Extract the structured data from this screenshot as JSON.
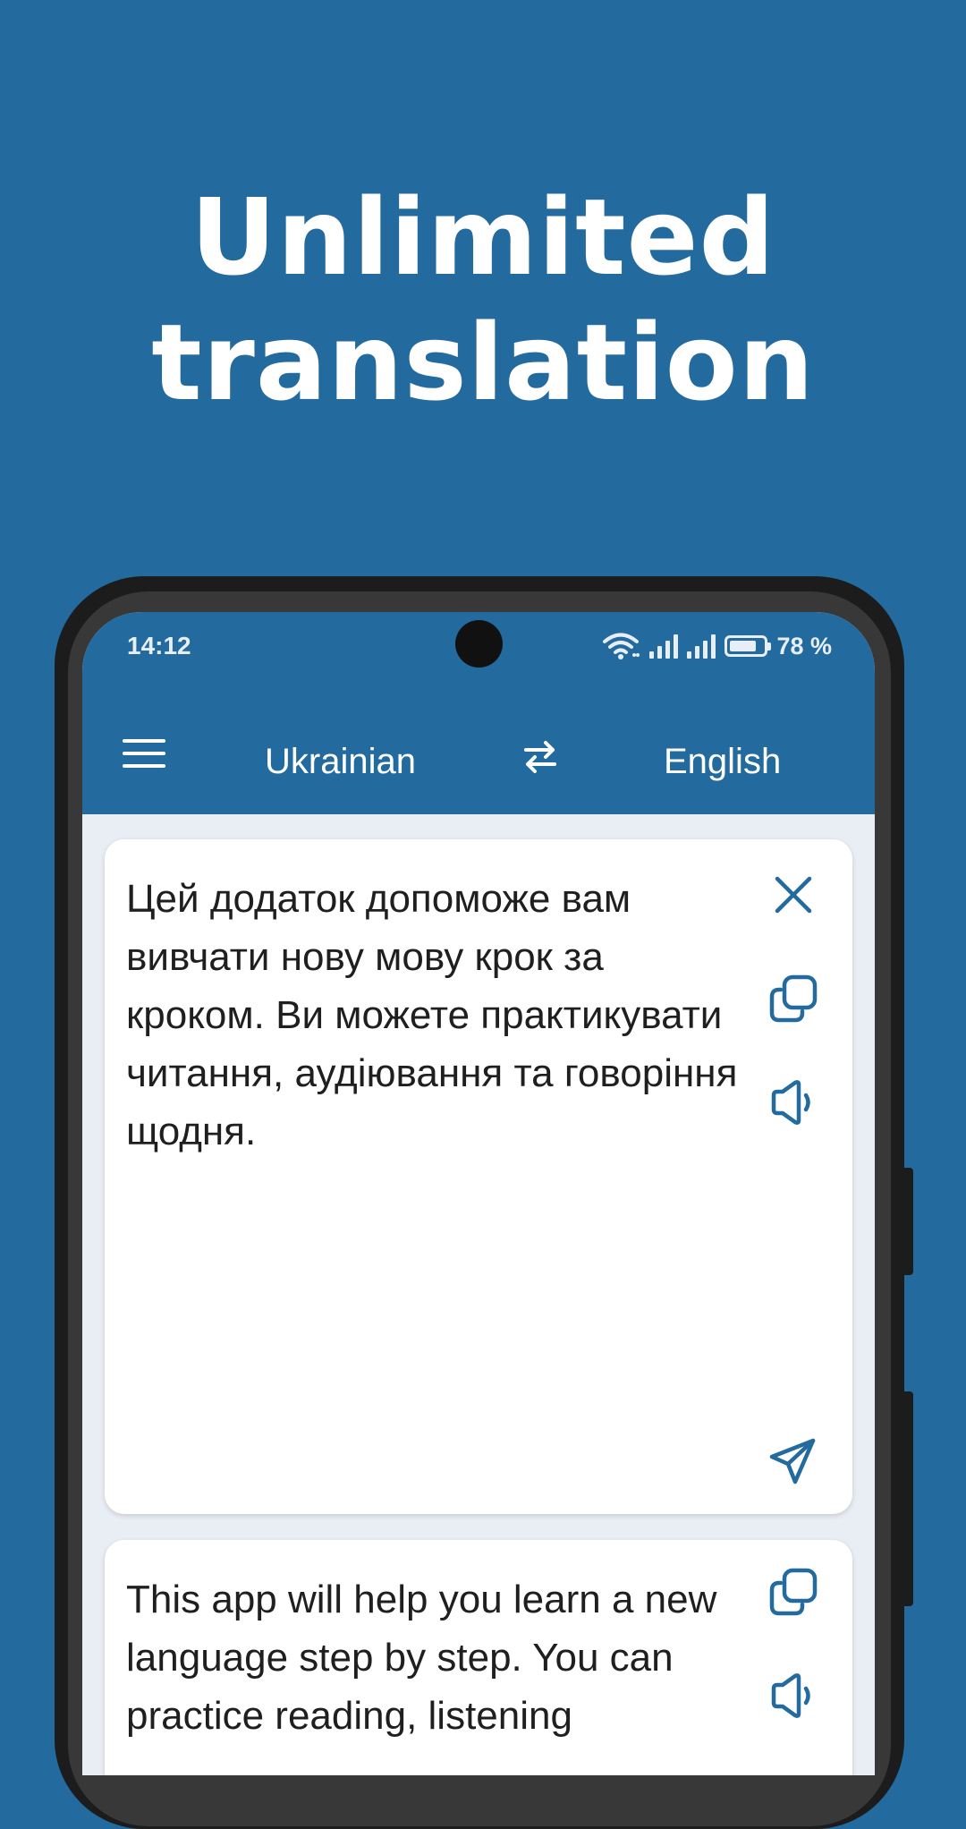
{
  "headline": {
    "line1": "Unlimited",
    "line2": "translation"
  },
  "status_bar": {
    "time": "14:12",
    "battery_percent": "78 %",
    "battery_level": 0.78
  },
  "toolbar": {
    "source_language": "Ukrainian",
    "target_language": "English"
  },
  "source_card": {
    "text": "Цей додаток допоможе вам вивчати нову мову крок за кроком. Ви можете практикувати читання, аудіювання та говоріння щодня."
  },
  "target_card": {
    "text": "This app will help you learn a new language step by step. You can practice reading, listening"
  },
  "colors": {
    "brand": "#236A9E",
    "icon": "#236A9E",
    "card_bg": "#FFFFFF",
    "screen_bg": "#E9EEF4"
  },
  "icons": [
    "menu-icon",
    "swap-icon",
    "close-icon",
    "copy-icon",
    "speaker-icon",
    "send-icon"
  ]
}
